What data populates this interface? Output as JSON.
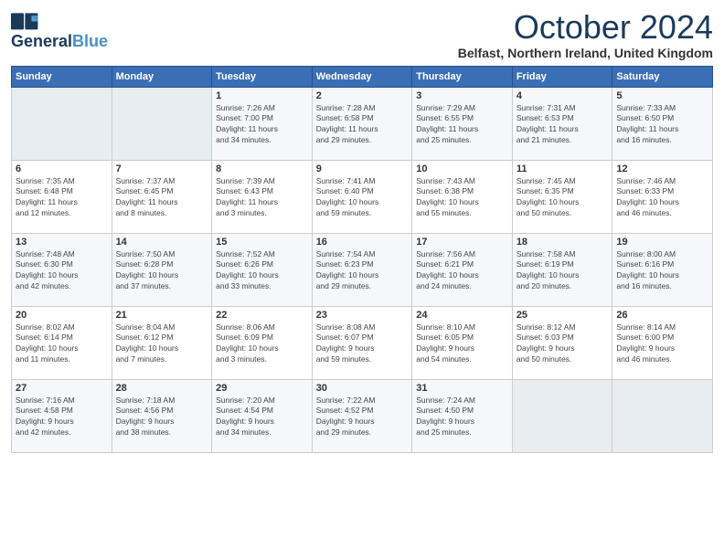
{
  "header": {
    "logo_line1": "General",
    "logo_line2": "Blue",
    "month_title": "October 2024",
    "location": "Belfast, Northern Ireland, United Kingdom"
  },
  "weekdays": [
    "Sunday",
    "Monday",
    "Tuesday",
    "Wednesday",
    "Thursday",
    "Friday",
    "Saturday"
  ],
  "weeks": [
    [
      {
        "day": "",
        "info": ""
      },
      {
        "day": "",
        "info": ""
      },
      {
        "day": "1",
        "info": "Sunrise: 7:26 AM\nSunset: 7:00 PM\nDaylight: 11 hours\nand 34 minutes."
      },
      {
        "day": "2",
        "info": "Sunrise: 7:28 AM\nSunset: 6:58 PM\nDaylight: 11 hours\nand 29 minutes."
      },
      {
        "day": "3",
        "info": "Sunrise: 7:29 AM\nSunset: 6:55 PM\nDaylight: 11 hours\nand 25 minutes."
      },
      {
        "day": "4",
        "info": "Sunrise: 7:31 AM\nSunset: 6:53 PM\nDaylight: 11 hours\nand 21 minutes."
      },
      {
        "day": "5",
        "info": "Sunrise: 7:33 AM\nSunset: 6:50 PM\nDaylight: 11 hours\nand 16 minutes."
      }
    ],
    [
      {
        "day": "6",
        "info": "Sunrise: 7:35 AM\nSunset: 6:48 PM\nDaylight: 11 hours\nand 12 minutes."
      },
      {
        "day": "7",
        "info": "Sunrise: 7:37 AM\nSunset: 6:45 PM\nDaylight: 11 hours\nand 8 minutes."
      },
      {
        "day": "8",
        "info": "Sunrise: 7:39 AM\nSunset: 6:43 PM\nDaylight: 11 hours\nand 3 minutes."
      },
      {
        "day": "9",
        "info": "Sunrise: 7:41 AM\nSunset: 6:40 PM\nDaylight: 10 hours\nand 59 minutes."
      },
      {
        "day": "10",
        "info": "Sunrise: 7:43 AM\nSunset: 6:38 PM\nDaylight: 10 hours\nand 55 minutes."
      },
      {
        "day": "11",
        "info": "Sunrise: 7:45 AM\nSunset: 6:35 PM\nDaylight: 10 hours\nand 50 minutes."
      },
      {
        "day": "12",
        "info": "Sunrise: 7:46 AM\nSunset: 6:33 PM\nDaylight: 10 hours\nand 46 minutes."
      }
    ],
    [
      {
        "day": "13",
        "info": "Sunrise: 7:48 AM\nSunset: 6:30 PM\nDaylight: 10 hours\nand 42 minutes."
      },
      {
        "day": "14",
        "info": "Sunrise: 7:50 AM\nSunset: 6:28 PM\nDaylight: 10 hours\nand 37 minutes."
      },
      {
        "day": "15",
        "info": "Sunrise: 7:52 AM\nSunset: 6:26 PM\nDaylight: 10 hours\nand 33 minutes."
      },
      {
        "day": "16",
        "info": "Sunrise: 7:54 AM\nSunset: 6:23 PM\nDaylight: 10 hours\nand 29 minutes."
      },
      {
        "day": "17",
        "info": "Sunrise: 7:56 AM\nSunset: 6:21 PM\nDaylight: 10 hours\nand 24 minutes."
      },
      {
        "day": "18",
        "info": "Sunrise: 7:58 AM\nSunset: 6:19 PM\nDaylight: 10 hours\nand 20 minutes."
      },
      {
        "day": "19",
        "info": "Sunrise: 8:00 AM\nSunset: 6:16 PM\nDaylight: 10 hours\nand 16 minutes."
      }
    ],
    [
      {
        "day": "20",
        "info": "Sunrise: 8:02 AM\nSunset: 6:14 PM\nDaylight: 10 hours\nand 11 minutes."
      },
      {
        "day": "21",
        "info": "Sunrise: 8:04 AM\nSunset: 6:12 PM\nDaylight: 10 hours\nand 7 minutes."
      },
      {
        "day": "22",
        "info": "Sunrise: 8:06 AM\nSunset: 6:09 PM\nDaylight: 10 hours\nand 3 minutes."
      },
      {
        "day": "23",
        "info": "Sunrise: 8:08 AM\nSunset: 6:07 PM\nDaylight: 9 hours\nand 59 minutes."
      },
      {
        "day": "24",
        "info": "Sunrise: 8:10 AM\nSunset: 6:05 PM\nDaylight: 9 hours\nand 54 minutes."
      },
      {
        "day": "25",
        "info": "Sunrise: 8:12 AM\nSunset: 6:03 PM\nDaylight: 9 hours\nand 50 minutes."
      },
      {
        "day": "26",
        "info": "Sunrise: 8:14 AM\nSunset: 6:00 PM\nDaylight: 9 hours\nand 46 minutes."
      }
    ],
    [
      {
        "day": "27",
        "info": "Sunrise: 7:16 AM\nSunset: 4:58 PM\nDaylight: 9 hours\nand 42 minutes."
      },
      {
        "day": "28",
        "info": "Sunrise: 7:18 AM\nSunset: 4:56 PM\nDaylight: 9 hours\nand 38 minutes."
      },
      {
        "day": "29",
        "info": "Sunrise: 7:20 AM\nSunset: 4:54 PM\nDaylight: 9 hours\nand 34 minutes."
      },
      {
        "day": "30",
        "info": "Sunrise: 7:22 AM\nSunset: 4:52 PM\nDaylight: 9 hours\nand 29 minutes."
      },
      {
        "day": "31",
        "info": "Sunrise: 7:24 AM\nSunset: 4:50 PM\nDaylight: 9 hours\nand 25 minutes."
      },
      {
        "day": "",
        "info": ""
      },
      {
        "day": "",
        "info": ""
      }
    ]
  ]
}
